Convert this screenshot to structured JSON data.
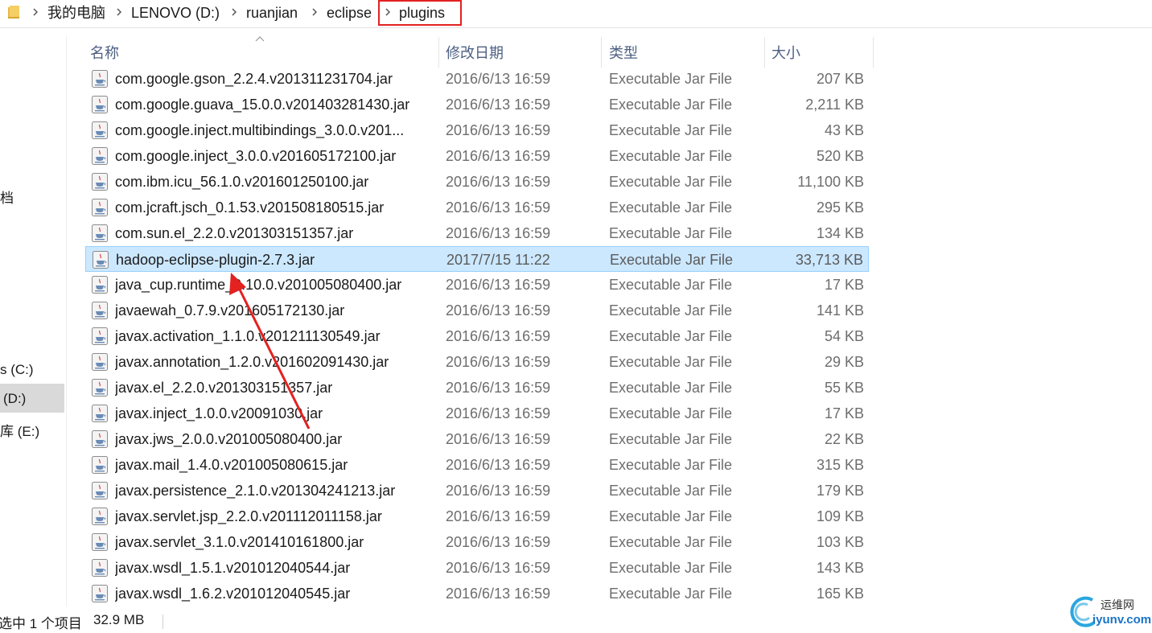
{
  "breadcrumb": {
    "items": [
      "我的电脑",
      "LENOVO (D:)",
      "ruanjian",
      "eclipse",
      "plugins"
    ]
  },
  "nav": {
    "items": [
      "档",
      "s (C:)",
      "(D:)",
      "库 (E:)"
    ]
  },
  "columns": {
    "name": "名称",
    "date": "修改日期",
    "type": "类型",
    "size": "大小"
  },
  "files": [
    {
      "name": "com.google.gson_2.2.4.v201311231704.jar",
      "date": "2016/6/13 16:59",
      "type": "Executable Jar File",
      "size": "207 KB"
    },
    {
      "name": "com.google.guava_15.0.0.v201403281430.jar",
      "date": "2016/6/13 16:59",
      "type": "Executable Jar File",
      "size": "2,211 KB"
    },
    {
      "name": "com.google.inject.multibindings_3.0.0.v201...",
      "date": "2016/6/13 16:59",
      "type": "Executable Jar File",
      "size": "43 KB"
    },
    {
      "name": "com.google.inject_3.0.0.v201605172100.jar",
      "date": "2016/6/13 16:59",
      "type": "Executable Jar File",
      "size": "520 KB"
    },
    {
      "name": "com.ibm.icu_56.1.0.v201601250100.jar",
      "date": "2016/6/13 16:59",
      "type": "Executable Jar File",
      "size": "11,100 KB"
    },
    {
      "name": "com.jcraft.jsch_0.1.53.v201508180515.jar",
      "date": "2016/6/13 16:59",
      "type": "Executable Jar File",
      "size": "295 KB"
    },
    {
      "name": "com.sun.el_2.2.0.v201303151357.jar",
      "date": "2016/6/13 16:59",
      "type": "Executable Jar File",
      "size": "134 KB"
    },
    {
      "name": "hadoop-eclipse-plugin-2.7.3.jar",
      "date": "2017/7/15 11:22",
      "type": "Executable Jar File",
      "size": "33,713 KB",
      "selected": true
    },
    {
      "name": "java_cup.runtime_0.10.0.v201005080400.jar",
      "date": "2016/6/13 16:59",
      "type": "Executable Jar File",
      "size": "17 KB"
    },
    {
      "name": "javaewah_0.7.9.v201605172130.jar",
      "date": "2016/6/13 16:59",
      "type": "Executable Jar File",
      "size": "141 KB"
    },
    {
      "name": "javax.activation_1.1.0.v201211130549.jar",
      "date": "2016/6/13 16:59",
      "type": "Executable Jar File",
      "size": "54 KB"
    },
    {
      "name": "javax.annotation_1.2.0.v201602091430.jar",
      "date": "2016/6/13 16:59",
      "type": "Executable Jar File",
      "size": "29 KB"
    },
    {
      "name": "javax.el_2.2.0.v201303151357.jar",
      "date": "2016/6/13 16:59",
      "type": "Executable Jar File",
      "size": "55 KB"
    },
    {
      "name": "javax.inject_1.0.0.v20091030.jar",
      "date": "2016/6/13 16:59",
      "type": "Executable Jar File",
      "size": "17 KB"
    },
    {
      "name": "javax.jws_2.0.0.v201005080400.jar",
      "date": "2016/6/13 16:59",
      "type": "Executable Jar File",
      "size": "22 KB"
    },
    {
      "name": "javax.mail_1.4.0.v201005080615.jar",
      "date": "2016/6/13 16:59",
      "type": "Executable Jar File",
      "size": "315 KB"
    },
    {
      "name": "javax.persistence_2.1.0.v201304241213.jar",
      "date": "2016/6/13 16:59",
      "type": "Executable Jar File",
      "size": "179 KB"
    },
    {
      "name": "javax.servlet.jsp_2.2.0.v201112011158.jar",
      "date": "2016/6/13 16:59",
      "type": "Executable Jar File",
      "size": "109 KB"
    },
    {
      "name": "javax.servlet_3.1.0.v201410161800.jar",
      "date": "2016/6/13 16:59",
      "type": "Executable Jar File",
      "size": "103 KB"
    },
    {
      "name": "javax.wsdl_1.5.1.v201012040544.jar",
      "date": "2016/6/13 16:59",
      "type": "Executable Jar File",
      "size": "143 KB"
    },
    {
      "name": "javax.wsdl_1.6.2.v201012040545.jar",
      "date": "2016/6/13 16:59",
      "type": "Executable Jar File",
      "size": "165 KB"
    }
  ],
  "status": {
    "selection": "选中 1 个项目",
    "size": "32.9 MB"
  },
  "watermark": {
    "cn": "运维网",
    "en": "iyunv.com"
  },
  "colors": {
    "selection_bg": "#cce8ff",
    "selection_border": "#99d1ff",
    "highlight_box": "#e32121",
    "annotation_arrow": "#e32121",
    "header_text": "#4d6082"
  },
  "icons": {
    "folder": "folder-icon",
    "file": "java-jar-icon",
    "separator": "chevron-right-icon",
    "sort": "sort-up-icon"
  }
}
